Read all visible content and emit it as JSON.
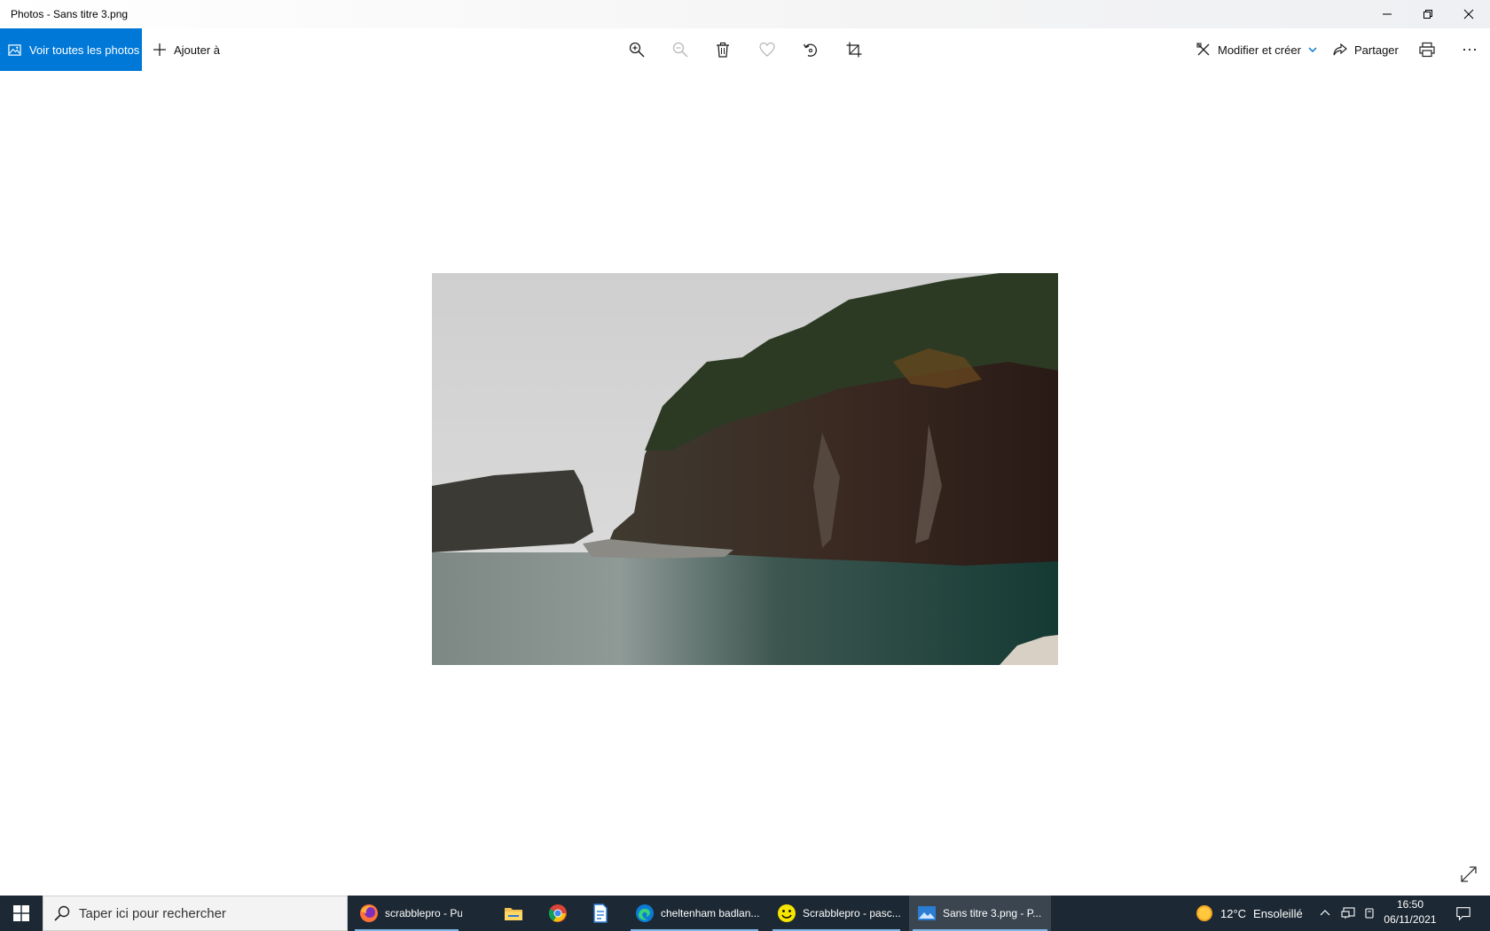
{
  "window": {
    "title": "Photos - Sans titre 3.png"
  },
  "toolbar": {
    "see_all_label": "Voir toutes les photos",
    "add_to_label": "Ajouter à",
    "edit_create_label": "Modifier et créer",
    "share_label": "Partager",
    "icons": [
      "zoom-in-icon",
      "zoom-out-icon",
      "delete-icon",
      "favorite-icon",
      "rotate-icon",
      "crop-icon",
      "print-icon",
      "more-icon"
    ]
  },
  "taskbar": {
    "search_placeholder": "Taper ici pour rechercher",
    "apps": [
      {
        "label": "scrabblepro - Publi...",
        "icon": "firefox-icon"
      },
      {
        "label": "cheltenham badlan...",
        "icon": "edge-icon"
      },
      {
        "label": "Scrabblepro - pasc...",
        "icon": "smiley-icon"
      },
      {
        "label": "Sans titre 3.png - P...",
        "icon": "photos-icon"
      }
    ],
    "pinned": [
      "file-explorer-icon",
      "chrome-icon",
      "document-icon"
    ],
    "weather": {
      "temp": "12°C",
      "condition": "Ensoleillé"
    },
    "time": "16:50",
    "date": "06/11/2021"
  },
  "colors": {
    "accent": "#0078d7",
    "taskbar": "#1c2833"
  }
}
